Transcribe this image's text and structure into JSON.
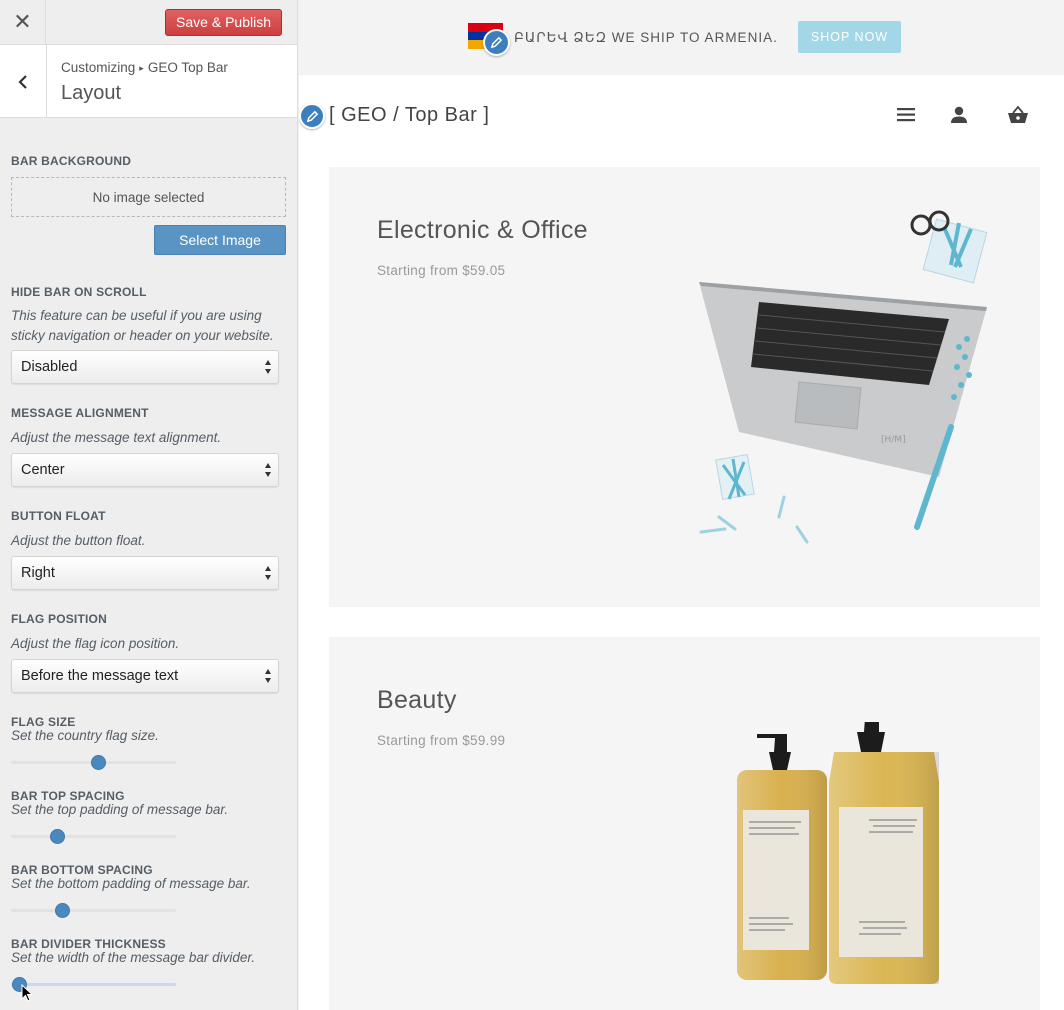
{
  "sidebar": {
    "close_glyph": "✕",
    "save_label": "Save & Publish",
    "breadcrumb": {
      "root": "Customizing",
      "sep": "▸",
      "current": "GEO Top Bar"
    },
    "section_title": "Layout",
    "bar_background": {
      "title": "Bar Background",
      "empty_text": "No image selected",
      "select_label": "Select Image"
    },
    "hide_bar": {
      "title": "Hide Bar on Scroll",
      "desc": "This feature can be useful if you are using sticky navigation or header on your website.",
      "value": "Disabled"
    },
    "message_alignment": {
      "title": "Message Alignment",
      "desc": "Adjust the message text alignment.",
      "value": "Center"
    },
    "button_float": {
      "title": "Button Float",
      "desc": "Adjust the button float.",
      "value": "Right"
    },
    "flag_position": {
      "title": "Flag Position",
      "desc": "Adjust the flag icon position.",
      "value": "Before the message text"
    },
    "flag_size": {
      "title": "Flag Size",
      "desc": "Set the country flag size.",
      "level": 0.53
    },
    "bar_top_spacing": {
      "title": "Bar Top Spacing",
      "desc": "Set the top padding of message bar.",
      "level": 0.28
    },
    "bar_bottom_spacing": {
      "title": "Bar Bottom Spacing",
      "desc": "Set the bottom padding of message bar.",
      "level": 0.31
    },
    "bar_divider": {
      "title": "Bar Divider Thickness",
      "desc": "Set the width of the message bar divider.",
      "level": 0.05
    }
  },
  "preview": {
    "bar_message": "ԲԱՐԵՎ ՁԵԶ WE SHIP TO ARMENIA.",
    "shop_now": "SHOP NOW",
    "site_title": "[ GEO / Top Bar ]",
    "flag_colors": [
      "#d90012",
      "#0033a0",
      "#f2a800"
    ],
    "cards": [
      {
        "title": "Electronic & Office",
        "subtitle": "Starting from $59.05"
      },
      {
        "title": "Beauty",
        "subtitle": "Starting from $59.99"
      }
    ]
  },
  "colors": {
    "save_button": "#d9534f",
    "accent_blue": "#4a89bf",
    "shop_now_bg": "#a2d7e8"
  },
  "icons": {
    "close": "close-icon",
    "back": "chevron-left-icon",
    "edit": "pencil-icon",
    "menu": "hamburger-menu-icon",
    "account": "user-icon",
    "cart": "basket-icon"
  }
}
